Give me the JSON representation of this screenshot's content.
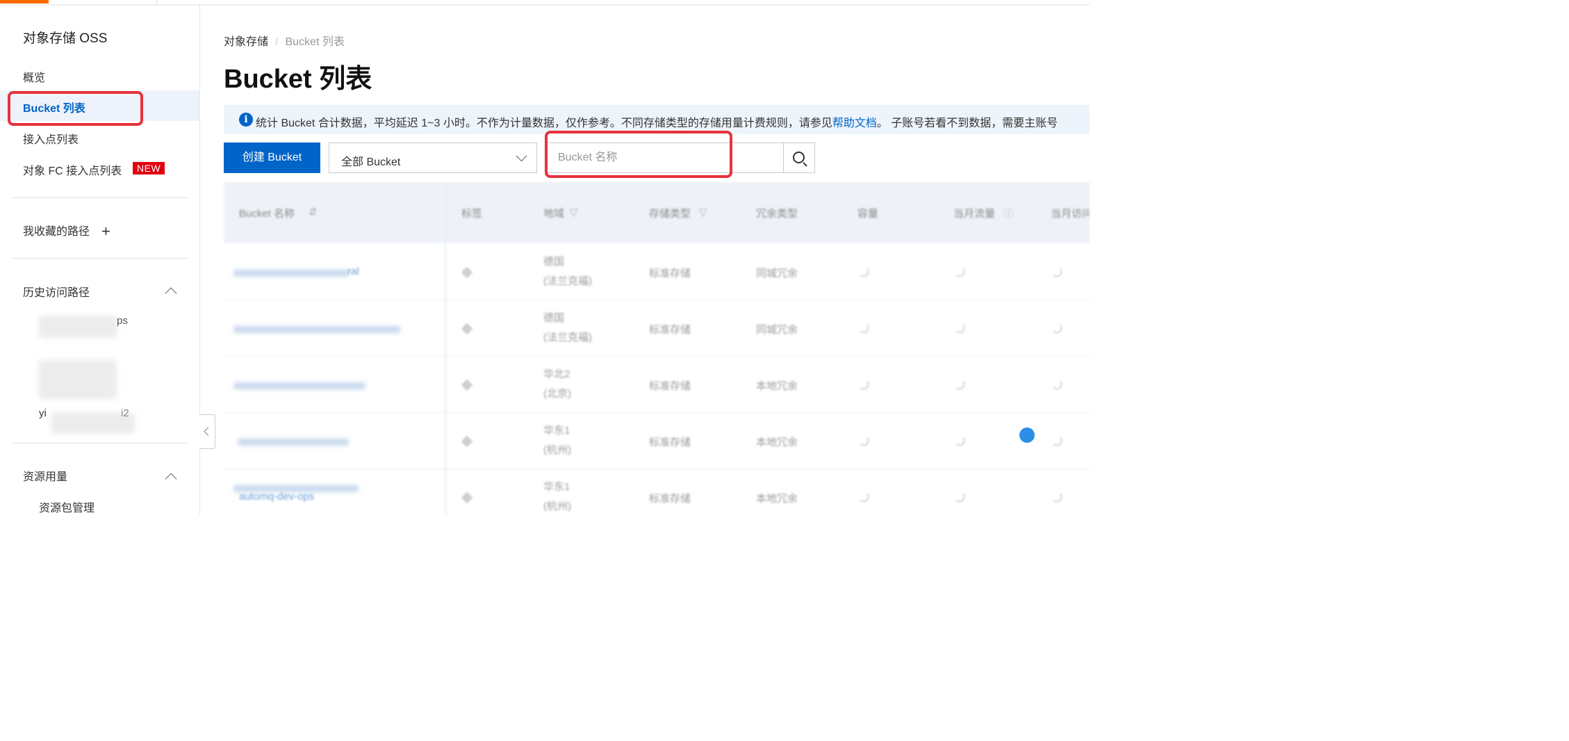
{
  "sidebar": {
    "title": "对象存储 OSS",
    "nav": [
      {
        "label": "概览"
      },
      {
        "label": "Bucket 列表"
      },
      {
        "label": "接入点列表"
      },
      {
        "label": "对象 FC 接入点列表",
        "badge": "NEW"
      }
    ],
    "favorites_label": "我收藏的路径",
    "favorites_add": "+",
    "history_label": "历史访问路径",
    "history_items": [
      "ps",
      "yi",
      "i2"
    ],
    "resource_label": "资源用量",
    "resource_items": [
      "资源包管理"
    ]
  },
  "breadcrumb": {
    "root": "对象存储",
    "separator": "/",
    "current": "Bucket 列表"
  },
  "page_title": "Bucket 列表",
  "notice": {
    "text": "统计 Bucket 合计数据，平均延迟 1~3 小时。不作为计量数据，仅作参考。不同存储类型的存储用量计费规则，请参见",
    "link": "帮助文档",
    "after": "。 子账号若看不到数据，需要主账号"
  },
  "toolbar": {
    "create_button": "创建 Bucket",
    "filter_value": "全部 Bucket",
    "search_placeholder": "Bucket 名称"
  },
  "table": {
    "columns": [
      "Bucket 名称",
      "标签",
      "地域",
      "存储类型",
      "冗余类型",
      "容量",
      "当月流量",
      "当月访问"
    ],
    "rows": [
      {
        "name": "ral",
        "region": "德国",
        "region_city": "(法兰克福)",
        "storage": "标准存储",
        "redundancy": "同城冗余"
      },
      {
        "name": "",
        "region": "德国",
        "region_city": "(法兰克福)",
        "storage": "标准存储",
        "redundancy": "同城冗余"
      },
      {
        "name": "",
        "region": "华北2",
        "region_city": "(北京)",
        "storage": "标准存储",
        "redundancy": "本地冗余"
      },
      {
        "name": "",
        "region": "华东1",
        "region_city": "(杭州)",
        "storage": "标准存储",
        "redundancy": "本地冗余"
      },
      {
        "name": "automq-dev-ops",
        "region": "华东1",
        "region_city": "(杭州)",
        "storage": "标准存储",
        "redundancy": "本地冗余"
      }
    ]
  },
  "colors": {
    "primary": "#0064c8",
    "highlight": "#e8323c",
    "accent": "#ff6a00",
    "badge": "#e0000f"
  }
}
